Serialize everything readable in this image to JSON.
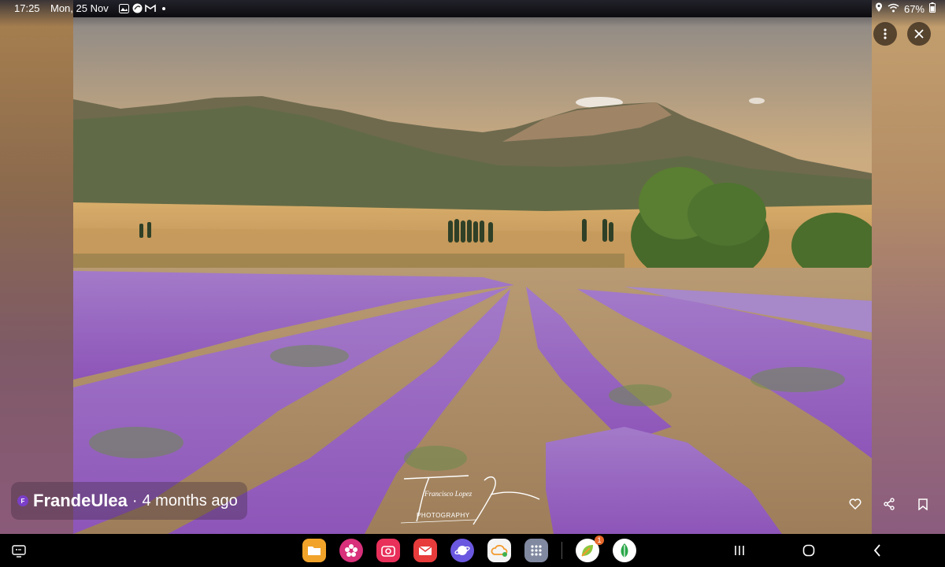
{
  "status_bar": {
    "time": "17:25",
    "date": "Mon, 25 Nov",
    "battery": "67%"
  },
  "author": {
    "initial": "F",
    "name": "FrandeUlea",
    "separator": "·",
    "time_ago": "4 months ago"
  },
  "watermark": {
    "signature": "Francisco Lopez",
    "subtitle": "PHOTOGRAPHY"
  },
  "dock": {
    "apps": [
      "files-app",
      "blossom-app",
      "camera-app",
      "email-app",
      "browser-app",
      "cloud-app",
      "apps-grid"
    ],
    "recent_apps": [
      "recent-app-1",
      "recent-app-2"
    ],
    "badge_count": "1"
  },
  "colors": {
    "sky_top": "#d9ae77",
    "lavender": "#9b6dc6",
    "accent_avatar": "#7b3fc9"
  }
}
